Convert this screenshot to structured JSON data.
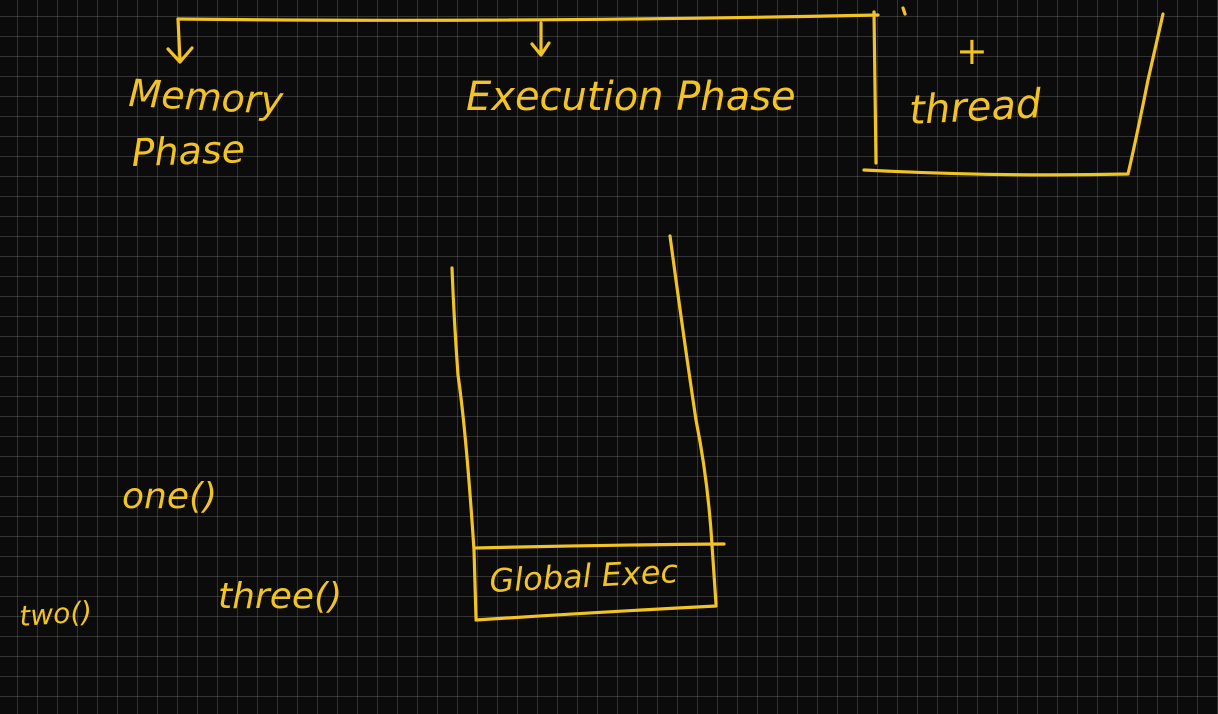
{
  "ink_color": "#f2c322",
  "background_color": "#0b0b0b",
  "labels": {
    "memory_phase_line1": "Memory",
    "memory_phase_line2": "Phase",
    "execution_phase": "Execution Phase",
    "plus_sign": "+",
    "thread": "thread",
    "global_exec": "Global Exec",
    "call_one": "one()",
    "call_two": "two()",
    "call_three": "three()"
  }
}
